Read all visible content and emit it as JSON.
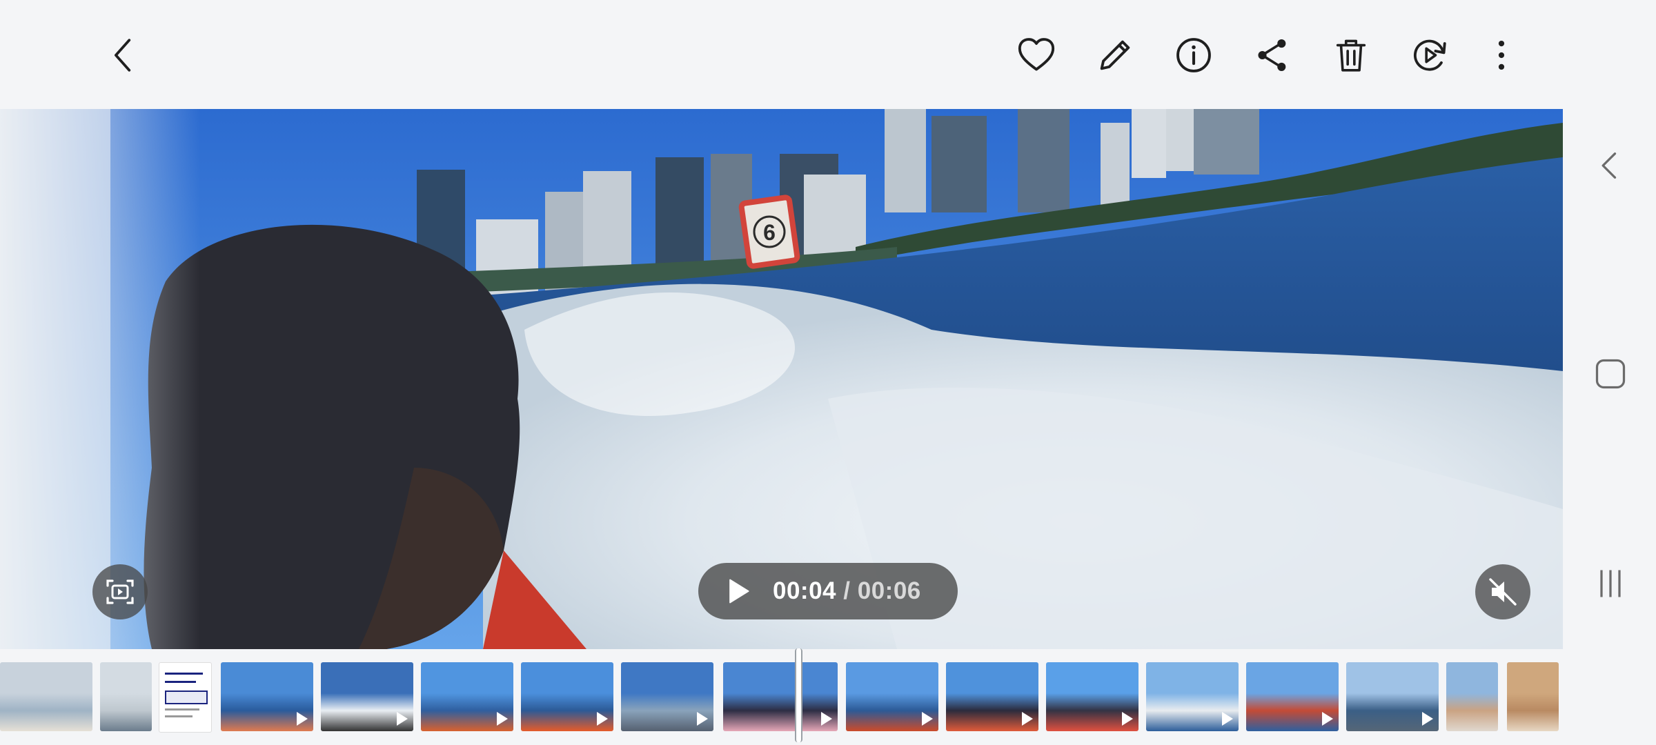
{
  "topbar": {
    "icons": [
      "back-icon",
      "heart-icon",
      "pencil-icon",
      "info-icon",
      "share-icon",
      "trash-icon",
      "remaster-icon",
      "more-vertical-icon"
    ]
  },
  "player": {
    "current_time": "00:04",
    "separator": "/",
    "duration": "00:06",
    "progress": 0.667,
    "muted": true,
    "sign_text": "6"
  },
  "navbar": {
    "icons": [
      "nav-back-icon",
      "nav-home-icon",
      "nav-recents-icon"
    ]
  },
  "filmstrip": {
    "thumbnails": [
      {
        "type": "photo",
        "colors": [
          "#c8d2dc",
          "#9fb3c5",
          "#e6e0d6"
        ]
      },
      {
        "type": "photo",
        "colors": [
          "#d3dbe2",
          "#bfc8cf",
          "#6b7c8c"
        ]
      },
      {
        "type": "screenshot",
        "colors": [
          "#ffffff",
          "#1a237e",
          "#e8eaf6"
        ]
      },
      {
        "type": "video",
        "colors": [
          "#4a8bd6",
          "#2a5b9c",
          "#e07a4f"
        ]
      },
      {
        "type": "video",
        "colors": [
          "#3a6fb8",
          "#e9eef3",
          "#333333"
        ]
      },
      {
        "type": "video",
        "colors": [
          "#5095e0",
          "#2f5f9f",
          "#d9612e"
        ]
      },
      {
        "type": "video",
        "colors": [
          "#4b8fdc",
          "#2c5a96",
          "#e55b2a"
        ]
      },
      {
        "type": "video",
        "colors": [
          "#3f78c4",
          "#8aa3bb",
          "#556070"
        ]
      },
      {
        "type": "video",
        "colors": [
          "#4a86d2",
          "#2d2d44",
          "#e6a7b7"
        ],
        "current": true
      },
      {
        "type": "video",
        "colors": [
          "#5a9ae2",
          "#2c5a96",
          "#cc4b2a"
        ]
      },
      {
        "type": "video",
        "colors": [
          "#4f92dc",
          "#2b2b3d",
          "#e05b3a"
        ]
      },
      {
        "type": "video",
        "colors": [
          "#5aa0e8",
          "#333344",
          "#e05040"
        ]
      },
      {
        "type": "video",
        "colors": [
          "#7fb3e6",
          "#e8ecef",
          "#2d5e9a"
        ]
      },
      {
        "type": "video",
        "colors": [
          "#6aa5e4",
          "#c44b36",
          "#2f5f9f"
        ]
      },
      {
        "type": "video",
        "colors": [
          "#9fc2e6",
          "#3b5f86",
          "#556677"
        ]
      },
      {
        "type": "photo",
        "colors": [
          "#8fb6de",
          "#caa383",
          "#e0d8cf"
        ]
      },
      {
        "type": "photo",
        "colors": [
          "#cfa77d",
          "#b98a62",
          "#e7d7c3"
        ]
      }
    ]
  }
}
